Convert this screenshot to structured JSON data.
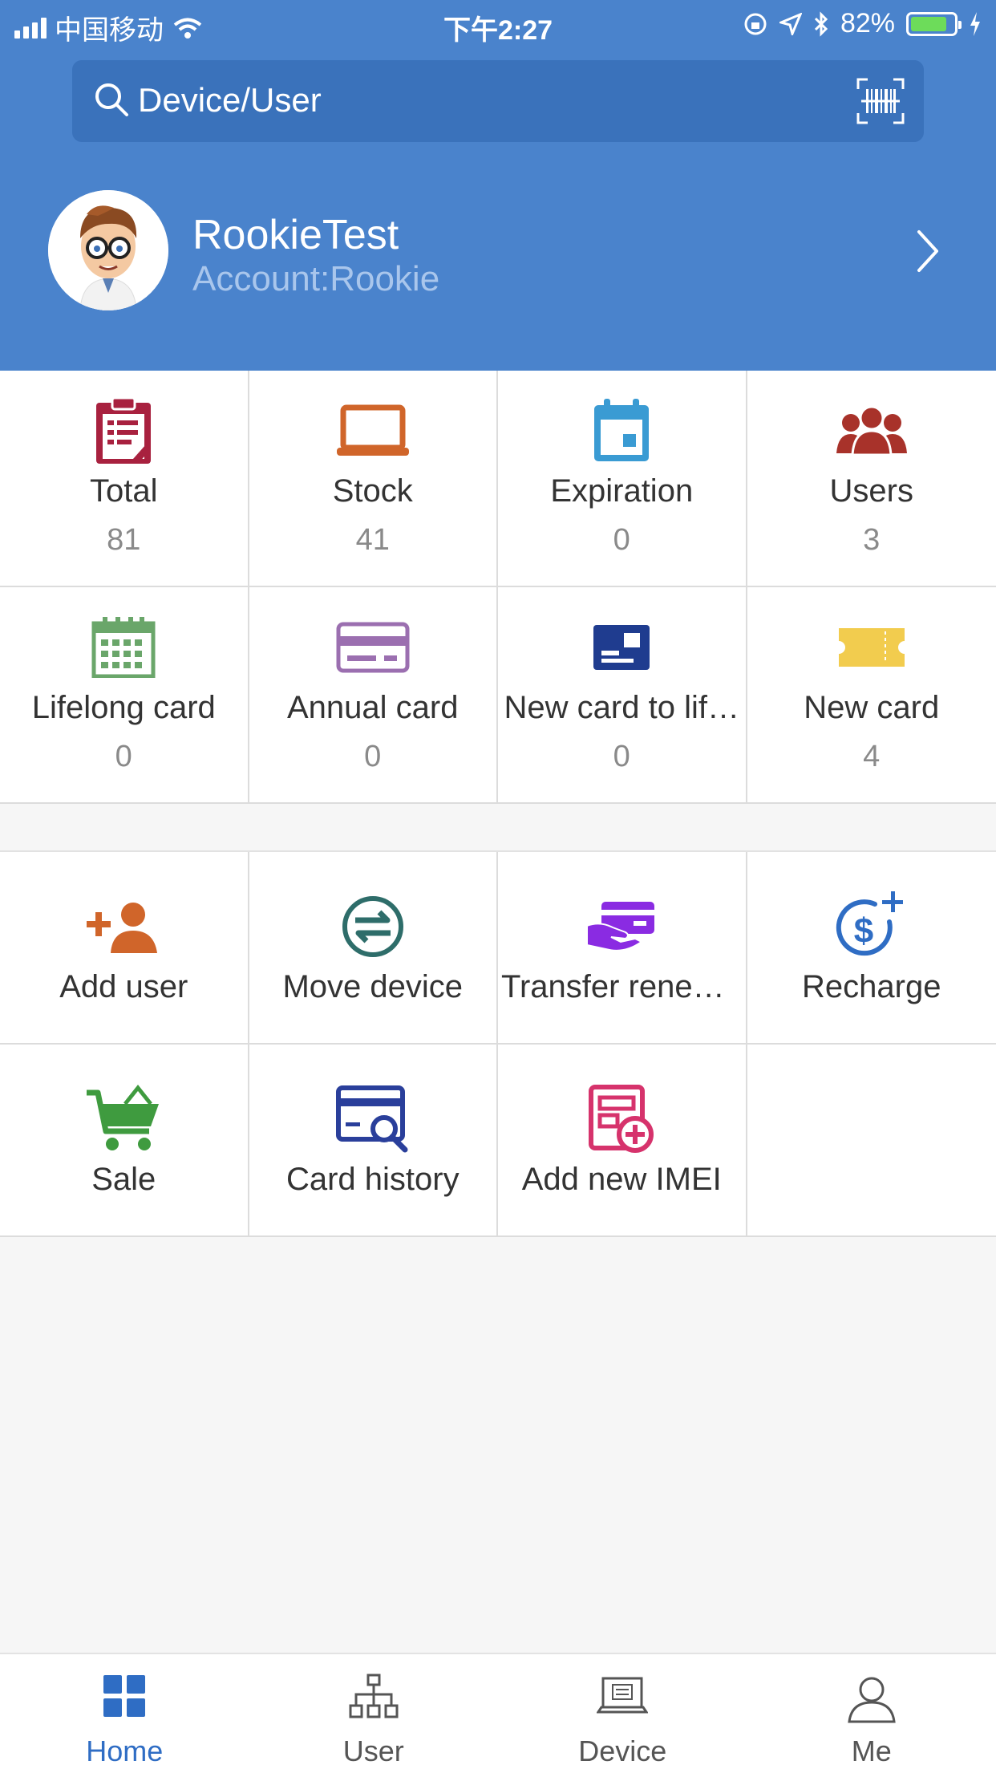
{
  "status_bar": {
    "carrier": "中国移动",
    "time": "下午2:27",
    "battery": "82%"
  },
  "search": {
    "placeholder": "Device/User"
  },
  "profile": {
    "name": "RookieTest",
    "account": "Account:Rookie"
  },
  "stats": [
    {
      "label": "Total",
      "value": "81",
      "icon": "clipboard-icon",
      "color": "#a8213f"
    },
    {
      "label": "Stock",
      "value": "41",
      "icon": "laptop-icon",
      "color": "#d0652a"
    },
    {
      "label": "Expiration",
      "value": "0",
      "icon": "calendar-icon",
      "color": "#3a9bd3"
    },
    {
      "label": "Users",
      "value": "3",
      "icon": "users-icon",
      "color": "#a8322a"
    },
    {
      "label": "Lifelong card",
      "value": "0",
      "icon": "calendar-grid-icon",
      "color": "#6aa66a"
    },
    {
      "label": "Annual card",
      "value": "0",
      "icon": "credit-card-icon",
      "color": "#9b6fb0"
    },
    {
      "label": "New card to lif…",
      "value": "0",
      "icon": "id-card-icon",
      "color": "#1f3c8f"
    },
    {
      "label": "New card",
      "value": "4",
      "icon": "ticket-icon",
      "color": "#f2cc4e"
    }
  ],
  "actions": [
    {
      "label": "Add user",
      "icon": "add-user-icon",
      "color": "#d0652a"
    },
    {
      "label": "Move device",
      "icon": "transfer-icon",
      "color": "#2e6d6a"
    },
    {
      "label": "Transfer renew…",
      "icon": "card-hand-icon",
      "color": "#8a2be2"
    },
    {
      "label": "Recharge",
      "icon": "dollar-plus-icon",
      "color": "#2f6dc4"
    },
    {
      "label": "Sale",
      "icon": "cart-icon",
      "color": "#3f9b3f"
    },
    {
      "label": "Card history",
      "icon": "card-search-icon",
      "color": "#2a3f9b"
    },
    {
      "label": "Add new IMEI",
      "icon": "imei-add-icon",
      "color": "#d6336c"
    }
  ],
  "tabs": [
    {
      "label": "Home",
      "active": true
    },
    {
      "label": "User",
      "active": false
    },
    {
      "label": "Device",
      "active": false
    },
    {
      "label": "Me",
      "active": false
    }
  ]
}
